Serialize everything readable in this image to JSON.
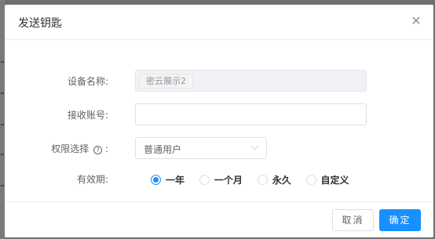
{
  "dialog": {
    "title": "发送钥匙",
    "close_icon": "close-icon"
  },
  "form": {
    "device_name": {
      "label": "设备名称:",
      "tag": "密云展示2"
    },
    "receiver_account": {
      "label": "接收账号:",
      "value": "",
      "placeholder": ""
    },
    "permission": {
      "label": "权限选择",
      "label_suffix": ":",
      "help_icon": "question-circle-icon",
      "selected": "普通用户",
      "arrow_icon": "chevron-down-icon"
    },
    "validity": {
      "label": "有效期:",
      "options": [
        {
          "label": "一年",
          "checked": true
        },
        {
          "label": "一个月",
          "checked": false
        },
        {
          "label": "永久",
          "checked": false
        },
        {
          "label": "自定义",
          "checked": false
        }
      ]
    }
  },
  "footer": {
    "cancel_label": "取消",
    "ok_label": "确定"
  },
  "colors": {
    "primary": "#1890ff",
    "overlay": "#6f6f6f"
  }
}
